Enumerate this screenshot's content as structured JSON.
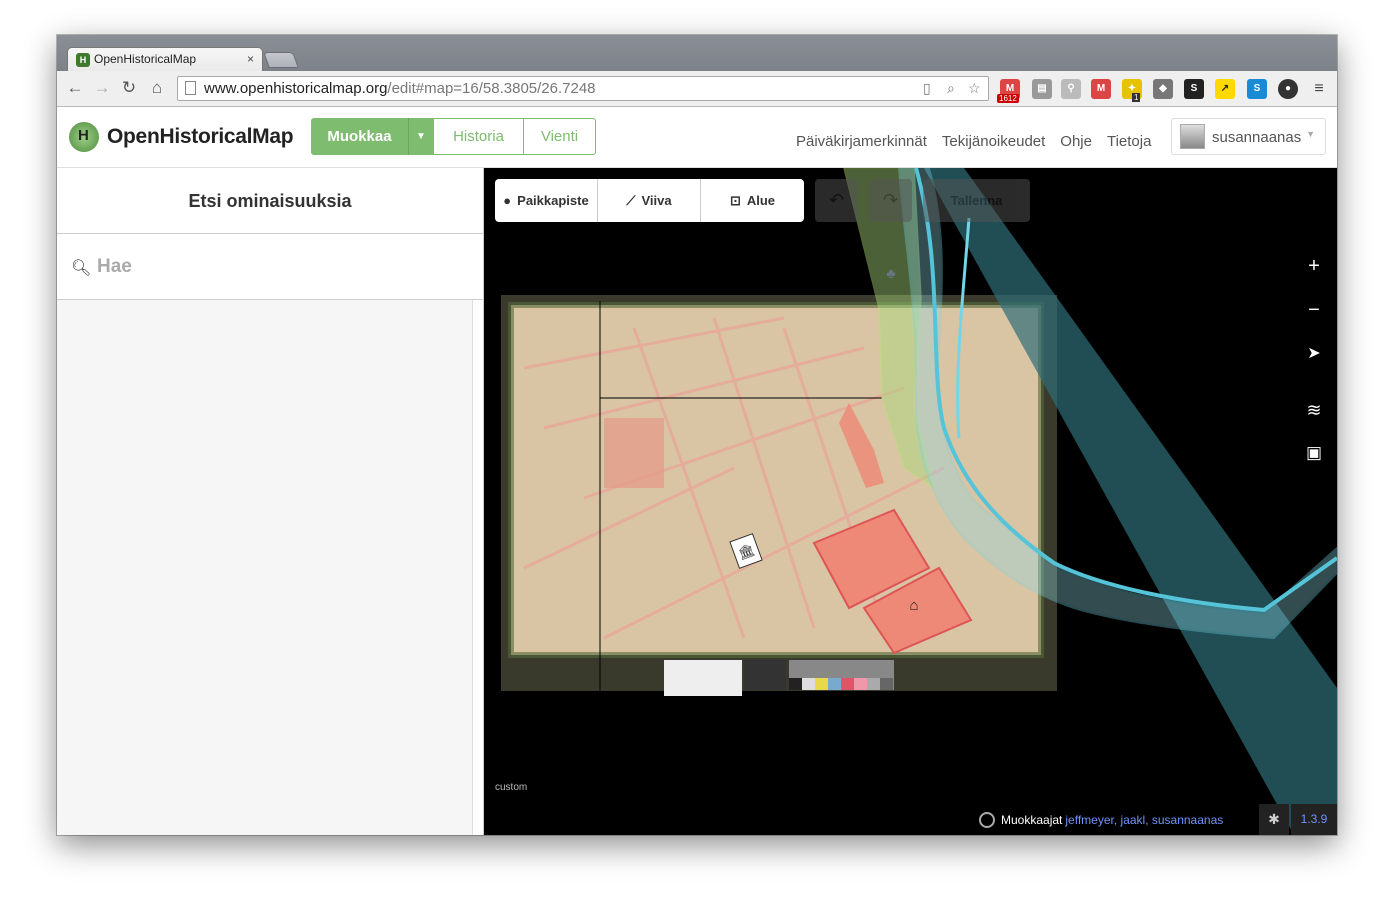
{
  "browser": {
    "tab_title": "OpenHistoricalMap",
    "tab_close": "×",
    "url_host": "www.openhistoricalmap.org",
    "url_path": "/edit#map=16/58.3805/26.7248",
    "ext_badge_1": "1612",
    "ext_badge_2": "1"
  },
  "header": {
    "site_name": "OpenHistoricalMap",
    "edit_label": "Muokkaa",
    "history_label": "Historia",
    "export_label": "Vienti",
    "links": [
      "Päiväkirjamerkinnät",
      "Tekijänoikeudet",
      "Ohje",
      "Tietoja"
    ],
    "username": "susannaanas"
  },
  "sidebar": {
    "title": "Etsi ominaisuuksia",
    "search_placeholder": "Hae"
  },
  "toolbar": {
    "modes": [
      "Paikkapiste",
      "Viiva",
      "Alue"
    ],
    "save_label": "Tallenna"
  },
  "map": {
    "imagery_label": "custom",
    "editors_label": "Muokkaajat",
    "editors": "jeffmeyer, jaakl, susannaanas",
    "version": "1.3.9"
  },
  "icons": {
    "zoom_in": "plus-icon",
    "zoom_out": "minus-icon",
    "locate": "location-arrow-icon",
    "layers": "layers-icon",
    "map_data": "map-data-icon"
  }
}
